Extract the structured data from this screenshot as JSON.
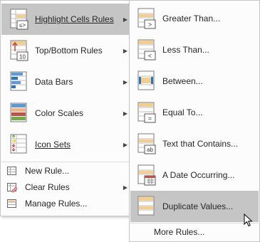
{
  "main_menu": {
    "items": [
      {
        "label": "Highlight Cells Rules",
        "icon": "highlight-cells-icon",
        "has_submenu": true
      },
      {
        "label": "Top/Bottom Rules",
        "icon": "top-bottom-icon",
        "has_submenu": true
      },
      {
        "label": "Data Bars",
        "icon": "data-bars-icon",
        "has_submenu": true
      },
      {
        "label": "Color Scales",
        "icon": "color-scales-icon",
        "has_submenu": true
      },
      {
        "label": "Icon Sets",
        "icon": "icon-sets-icon",
        "has_submenu": true
      },
      {
        "label": "New Rule...",
        "icon": "new-rule-icon"
      },
      {
        "label": "Clear Rules",
        "icon": "clear-rules-icon",
        "has_submenu": true
      },
      {
        "label": "Manage Rules...",
        "icon": "manage-rules-icon"
      }
    ]
  },
  "sub_menu": {
    "items": [
      {
        "label": "Greater Than...",
        "icon": "greater-than-icon",
        "glyph": ">"
      },
      {
        "label": "Less Than...",
        "icon": "less-than-icon",
        "glyph": "<"
      },
      {
        "label": "Between...",
        "icon": "between-icon"
      },
      {
        "label": "Equal To...",
        "icon": "equal-to-icon",
        "glyph": "="
      },
      {
        "label": "Text that Contains...",
        "icon": "text-contains-icon",
        "glyph": "ab"
      },
      {
        "label": "A Date Occurring...",
        "icon": "date-occurring-icon"
      },
      {
        "label": "Duplicate Values...",
        "icon": "duplicate-values-icon"
      },
      {
        "label": "More Rules...",
        "icon": "more-rules-icon"
      }
    ]
  },
  "top_bottom_badge": "10",
  "colors": {
    "highlight": "#c5c5c5",
    "cell_fill": "#f2cf8c",
    "bar_blue": "#2e75b6",
    "menu_bg": "#fcfcfc",
    "border": "#c6c6c6"
  }
}
